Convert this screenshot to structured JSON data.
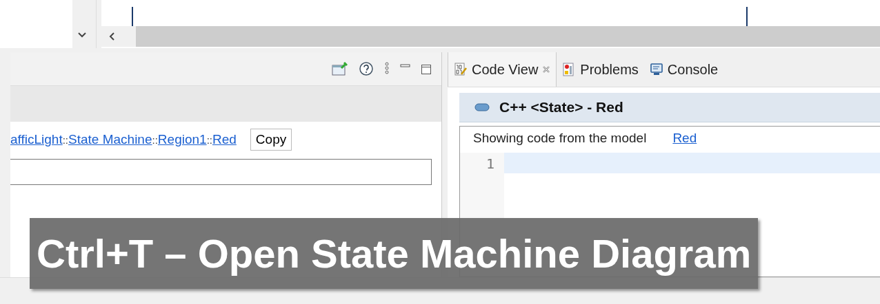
{
  "left_panel": {
    "breadcrumb": [
      {
        "text": "afficLight"
      },
      {
        "text": "State Machine"
      },
      {
        "text": "Region1"
      },
      {
        "text": "Red"
      }
    ],
    "separator": "::",
    "copy_button": "Copy"
  },
  "right_panel": {
    "tabs": [
      {
        "label": "Code View",
        "kind": "code",
        "selected": true,
        "closable": true
      },
      {
        "label": "Problems",
        "kind": "problems",
        "selected": false,
        "closable": false
      },
      {
        "label": "Console",
        "kind": "console",
        "selected": false,
        "closable": false
      }
    ],
    "header": "C++ <State> - Red",
    "info_text": "Showing code from the model",
    "info_link": "Red",
    "line_numbers": [
      "1"
    ]
  },
  "caption": "Ctrl+T – Open State Machine Diagram"
}
